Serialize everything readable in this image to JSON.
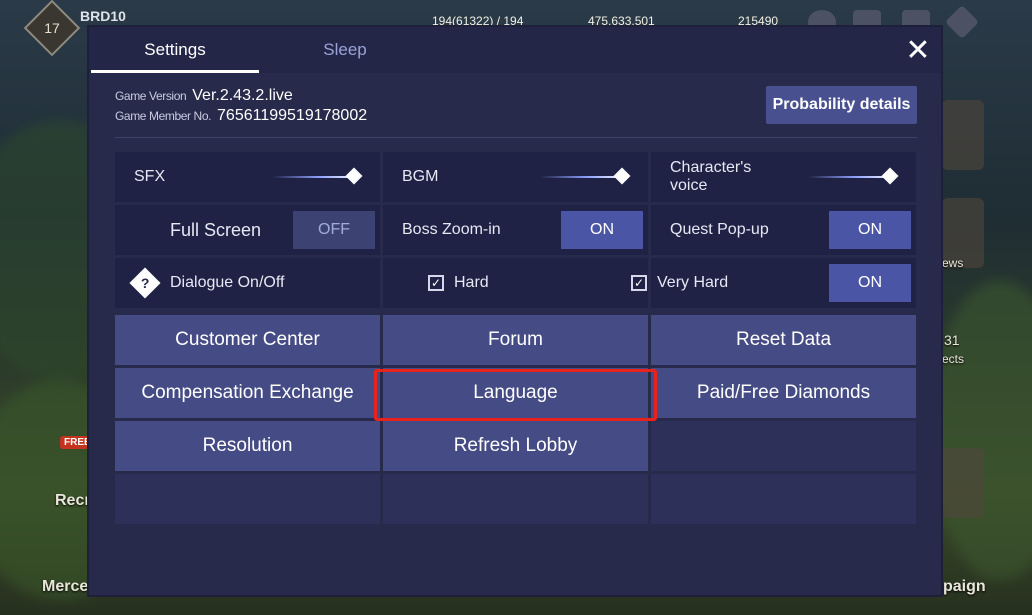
{
  "hud": {
    "level": "17",
    "player_name": "BRD10",
    "stamina": "194(61322) / 194",
    "gold": "475,633,501",
    "diamonds": "215490",
    "bg_labels": {
      "recruit": "Recr",
      "recruit_badge": "FREE",
      "mercenary": "Merce",
      "campaign": "paign",
      "news": "ews",
      "objects": "ects",
      "objects_count": "31"
    }
  },
  "modal": {
    "tabs": [
      {
        "label": "Settings"
      },
      {
        "label": "Sleep"
      }
    ],
    "close_icon": "close-icon",
    "info": {
      "version_label": "Game Version",
      "version_value": "Ver.2.43.2.live",
      "member_label": "Game Member No.",
      "member_value": "76561199519178002"
    },
    "probability_button": "Probability details",
    "audio": {
      "sfx": "SFX",
      "bgm": "BGM",
      "voice": "Character's voice",
      "sfx_level": 1.0,
      "bgm_level": 1.0,
      "voice_level": 1.0
    },
    "toggles": {
      "full_screen": {
        "label": "Full Screen",
        "state": "OFF"
      },
      "boss_zoom": {
        "label": "Boss Zoom-in",
        "state": "ON"
      },
      "quest_popup": {
        "label": "Quest Pop-up",
        "state": "ON"
      }
    },
    "dialogue": {
      "label": "Dialogue On/Off",
      "hard_label": "Hard",
      "very_hard_label": "Very Hard",
      "checkmark": "✓",
      "state": "ON"
    },
    "menu_buttons": [
      "Customer Center",
      "Forum",
      "Reset Data",
      "Compensation Exchange",
      "Language",
      "Paid/Free Diamonds",
      "Resolution",
      "Refresh Lobby"
    ],
    "colors": {
      "modal_bg": "#272a4a",
      "button_bg": "#454b84",
      "toggle_on": "#4b55a6",
      "highlight": "#e7231b"
    }
  }
}
